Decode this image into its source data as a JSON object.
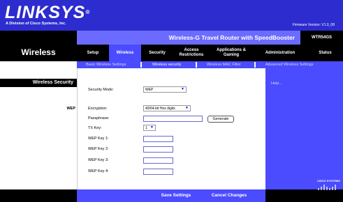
{
  "brand": {
    "logo": "LINKSYS",
    "registered": "®",
    "sub": "A Division of Cisco Systems, Inc."
  },
  "firmware": "Firmware Version: V1.0_08",
  "product_title": "Wireless-G Travel Router with SpeedBooster",
  "model": "WTR54GS",
  "section": "Wireless",
  "tabs": [
    {
      "label": "Setup",
      "active": false
    },
    {
      "label": "Wireless",
      "active": true
    },
    {
      "label": "Security",
      "active": false
    },
    {
      "label": "Access Restrictions",
      "active": false
    },
    {
      "label": "Applications & Gaming",
      "active": false
    },
    {
      "label": "Administration",
      "active": false
    },
    {
      "label": "Status",
      "active": false
    }
  ],
  "subtabs": [
    {
      "label": "Basic Wireless Settings",
      "active": false
    },
    {
      "label": "Wireless security",
      "active": true
    },
    {
      "label": "Wireless MAC Filter",
      "active": false
    },
    {
      "label": "Advanced Wireless Settings",
      "active": false
    }
  ],
  "left": {
    "section_title": "Wireless Security",
    "group_label": "WEP"
  },
  "form": {
    "security_mode": {
      "label": "Security Mode:",
      "value": "WEP"
    },
    "encryption": {
      "label": "Encryption:",
      "value": "40/64-bit Hex digits"
    },
    "passphrase": {
      "label": "Passphrase:",
      "value": "",
      "button": "Generate"
    },
    "tx_key": {
      "label": "TX Key:",
      "value": "1"
    },
    "keys": [
      {
        "label": "WEP Key 1:",
        "value": ""
      },
      {
        "label": "WEP Key 2:",
        "value": ""
      },
      {
        "label": "WEP Key 3:",
        "value": ""
      },
      {
        "label": "WEP Key 4:",
        "value": ""
      }
    ]
  },
  "help": {
    "link": "Help..."
  },
  "footer": {
    "save": "Save Settings",
    "cancel": "Cancel Changes"
  },
  "cisco": "CISCO SYSTEMS",
  "colors": {
    "brand_blue": "#2c2ccf",
    "bar_blue": "#4b4bff",
    "title_blue": "#6b6bff"
  }
}
